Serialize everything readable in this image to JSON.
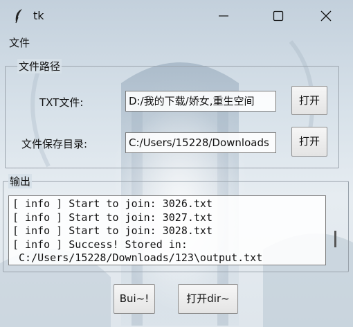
{
  "window": {
    "title": "tk"
  },
  "menu": {
    "file_label": "文件"
  },
  "path_group": {
    "legend": "文件路径",
    "txt_label": "TXT文件:",
    "txt_value": "D:/我的下载/娇女,重生空间",
    "txt_open": "打开",
    "save_label": "文件保存目录:",
    "save_value": "C:/Users/15228/Downloads",
    "save_open": "打开"
  },
  "output_group": {
    "legend": "输出",
    "lines": [
      "[ info ] Start to join: 3026.txt",
      "[ info ] Start to join: 3027.txt",
      "[ info ] Start to join: 3028.txt",
      "[ info ] Success! Stored in:",
      " C:/Users/15228/Downloads/123\\output.txt"
    ]
  },
  "actions": {
    "build_label": "Bui~!",
    "open_dir_label": "打开dir~"
  },
  "icons": {
    "app": "feather-icon",
    "minimize": "minimize-icon",
    "maximize": "maximize-icon",
    "close": "close-icon"
  }
}
